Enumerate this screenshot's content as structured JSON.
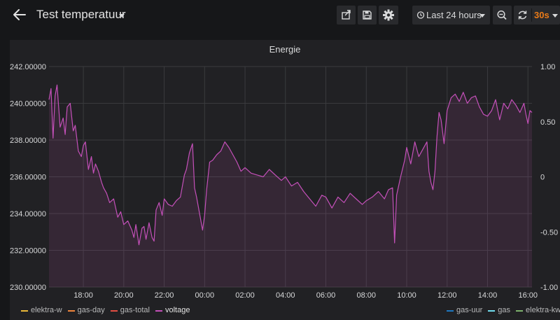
{
  "header": {
    "title": "Test temperatuur",
    "time_range": "Last 24 hours",
    "refresh_interval": "30s"
  },
  "panel": {
    "title": "Energie"
  },
  "colors": {
    "voltage": "#c450b9",
    "grid": "#3a3b3e",
    "refresh": "#eb7b18"
  },
  "chart_data": {
    "type": "line",
    "title": "Energie",
    "grid": true,
    "legend_position": "bottom",
    "y_left": {
      "min": 230,
      "max": 242,
      "ticks": [
        "242.00000",
        "240.00000",
        "238.00000",
        "236.00000",
        "234.00000",
        "232.00000",
        "230.00000"
      ]
    },
    "y_right": {
      "min": -1,
      "max": 1,
      "ticks": [
        "1.00",
        "0.50",
        "0",
        "-0.50",
        "-1.00"
      ]
    },
    "x_ticks": [
      "18:00",
      "20:00",
      "22:00",
      "00:00",
      "02:00",
      "04:00",
      "06:00",
      "08:00",
      "10:00",
      "12:00",
      "14:00",
      "16:00"
    ],
    "x_tick_hours": [
      18,
      20,
      22,
      24,
      26,
      28,
      30,
      32,
      34,
      36,
      38,
      40
    ],
    "x_range_hours": [
      16.3,
      40.2
    ],
    "series": [
      {
        "name": "voltage",
        "axis": "left",
        "x_hours": [
          16.3,
          16.4,
          16.5,
          16.6,
          16.7,
          16.85,
          17.0,
          17.1,
          17.2,
          17.35,
          17.5,
          17.6,
          17.75,
          17.9,
          18.0,
          18.1,
          18.25,
          18.4,
          18.5,
          18.6,
          18.75,
          18.9,
          19.0,
          19.15,
          19.3,
          19.5,
          19.7,
          19.85,
          20.0,
          20.2,
          20.4,
          20.5,
          20.6,
          20.75,
          20.9,
          21.0,
          21.1,
          21.25,
          21.4,
          21.5,
          21.6,
          21.75,
          21.9,
          22.0,
          22.2,
          22.4,
          22.6,
          22.8,
          23.0,
          23.1,
          23.25,
          23.4,
          23.5,
          23.6,
          23.75,
          23.9,
          24.0,
          24.1,
          24.25,
          24.4,
          24.6,
          24.8,
          25.0,
          25.2,
          25.4,
          25.6,
          25.8,
          26.0,
          26.3,
          26.6,
          26.9,
          27.2,
          27.5,
          27.8,
          28.0,
          28.3,
          28.6,
          28.9,
          29.2,
          29.5,
          29.8,
          30.0,
          30.3,
          30.6,
          30.9,
          31.2,
          31.5,
          31.8,
          32.0,
          32.3,
          32.6,
          32.9,
          33.1,
          33.3,
          33.4,
          33.5,
          33.7,
          33.9,
          34.0,
          34.2,
          34.4,
          34.6,
          34.8,
          35.0,
          35.1,
          35.2,
          35.3,
          35.4,
          35.5,
          35.6,
          35.7,
          35.85,
          36.0,
          36.2,
          36.4,
          36.6,
          36.8,
          37.0,
          37.2,
          37.4,
          37.6,
          37.8,
          38.0,
          38.2,
          38.4,
          38.6,
          38.8,
          39.0,
          39.2,
          39.4,
          39.6,
          39.8,
          39.9,
          40.0,
          40.1,
          40.2
        ],
        "values": [
          240.2,
          240.8,
          238.1,
          240.4,
          241.0,
          238.7,
          239.2,
          238.3,
          239.8,
          240.0,
          238.5,
          238.8,
          237.4,
          237.1,
          237.7,
          237.9,
          236.4,
          237.1,
          236.2,
          236.7,
          236.3,
          235.7,
          235.4,
          235.1,
          234.6,
          234.8,
          233.8,
          234.1,
          233.4,
          233.6,
          233.1,
          232.7,
          233.4,
          232.3,
          233.2,
          233.3,
          232.6,
          233.5,
          232.7,
          232.5,
          234.2,
          234.6,
          233.9,
          234.8,
          234.5,
          234.4,
          234.7,
          234.9,
          236.1,
          236.4,
          237.3,
          237.8,
          235.4,
          234.9,
          234.0,
          233.1,
          233.9,
          235.3,
          236.8,
          236.9,
          237.2,
          237.4,
          237.9,
          237.6,
          237.2,
          236.8,
          236.3,
          236.5,
          236.2,
          236.1,
          236.0,
          236.4,
          236.1,
          235.8,
          236.0,
          235.5,
          235.7,
          235.2,
          234.8,
          234.4,
          235.0,
          234.9,
          234.3,
          234.9,
          234.6,
          235.1,
          234.8,
          234.5,
          234.7,
          234.9,
          235.2,
          234.8,
          235.3,
          235.4,
          232.4,
          235.0,
          236.0,
          236.9,
          237.6,
          236.7,
          237.9,
          237.1,
          237.5,
          237.9,
          236.3,
          235.7,
          235.3,
          236.3,
          238.2,
          239.5,
          239.1,
          237.8,
          239.6,
          240.3,
          240.5,
          240.1,
          240.6,
          240.0,
          240.3,
          240.4,
          239.8,
          239.4,
          239.3,
          239.6,
          240.2,
          239.1,
          240.0,
          239.7,
          240.2,
          239.9,
          239.5,
          240.0,
          239.4,
          238.9,
          239.6,
          239.5
        ]
      }
    ]
  },
  "legend": {
    "left": [
      {
        "name": "elektra-w",
        "color": "#eab839"
      },
      {
        "name": "gas-day",
        "color": "#ef843c"
      },
      {
        "name": "gas-total",
        "color": "#e24d42"
      },
      {
        "name": "voltage",
        "color": "#c450b9"
      }
    ],
    "right": [
      {
        "name": "gas-uur",
        "color": "#1f78c1"
      },
      {
        "name": "gas",
        "color": "#70dbed"
      },
      {
        "name": "elektra-kwh",
        "color": "#7eb26d"
      }
    ]
  }
}
